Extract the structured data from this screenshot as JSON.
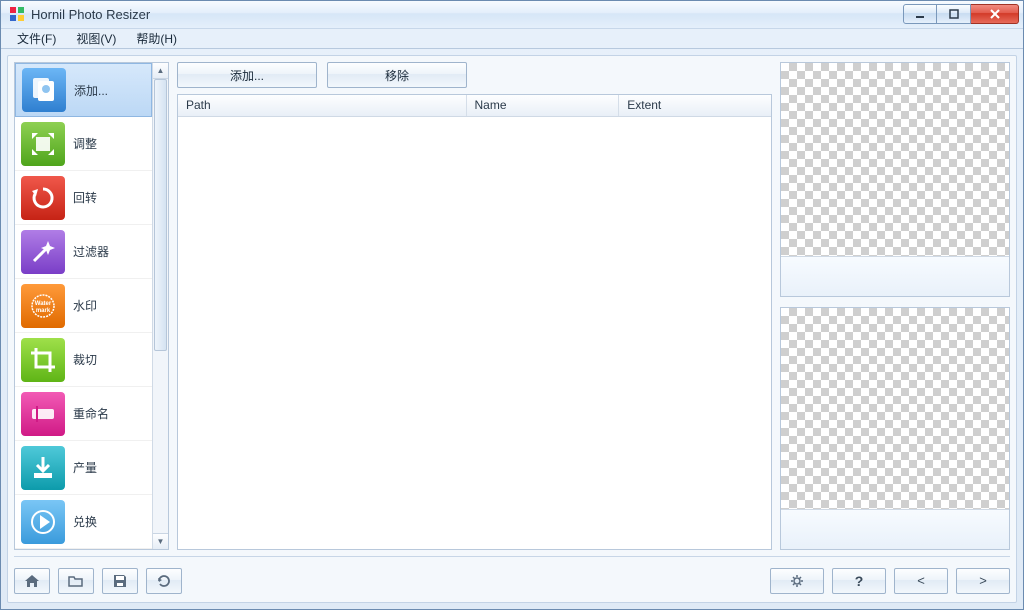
{
  "window": {
    "title": "Hornil Photo Resizer"
  },
  "menu": {
    "file": "文件(F)",
    "view": "视图(V)",
    "help": "帮助(H)"
  },
  "sidebar": {
    "items": [
      {
        "label": "添加...",
        "selected": true
      },
      {
        "label": "调整"
      },
      {
        "label": "回转"
      },
      {
        "label": "过滤器"
      },
      {
        "label": "水印"
      },
      {
        "label": "裁切"
      },
      {
        "label": "重命名"
      },
      {
        "label": "产量"
      },
      {
        "label": "兑换"
      }
    ]
  },
  "toolbar": {
    "add": "添加...",
    "remove": "移除"
  },
  "list": {
    "columns": {
      "path": "Path",
      "name": "Name",
      "extent": "Extent"
    },
    "rows": []
  },
  "bottom": {
    "home": "home",
    "open": "open",
    "save": "save",
    "refresh": "refresh",
    "settings": "settings",
    "help": "?",
    "prev": "<",
    "next": ">"
  }
}
